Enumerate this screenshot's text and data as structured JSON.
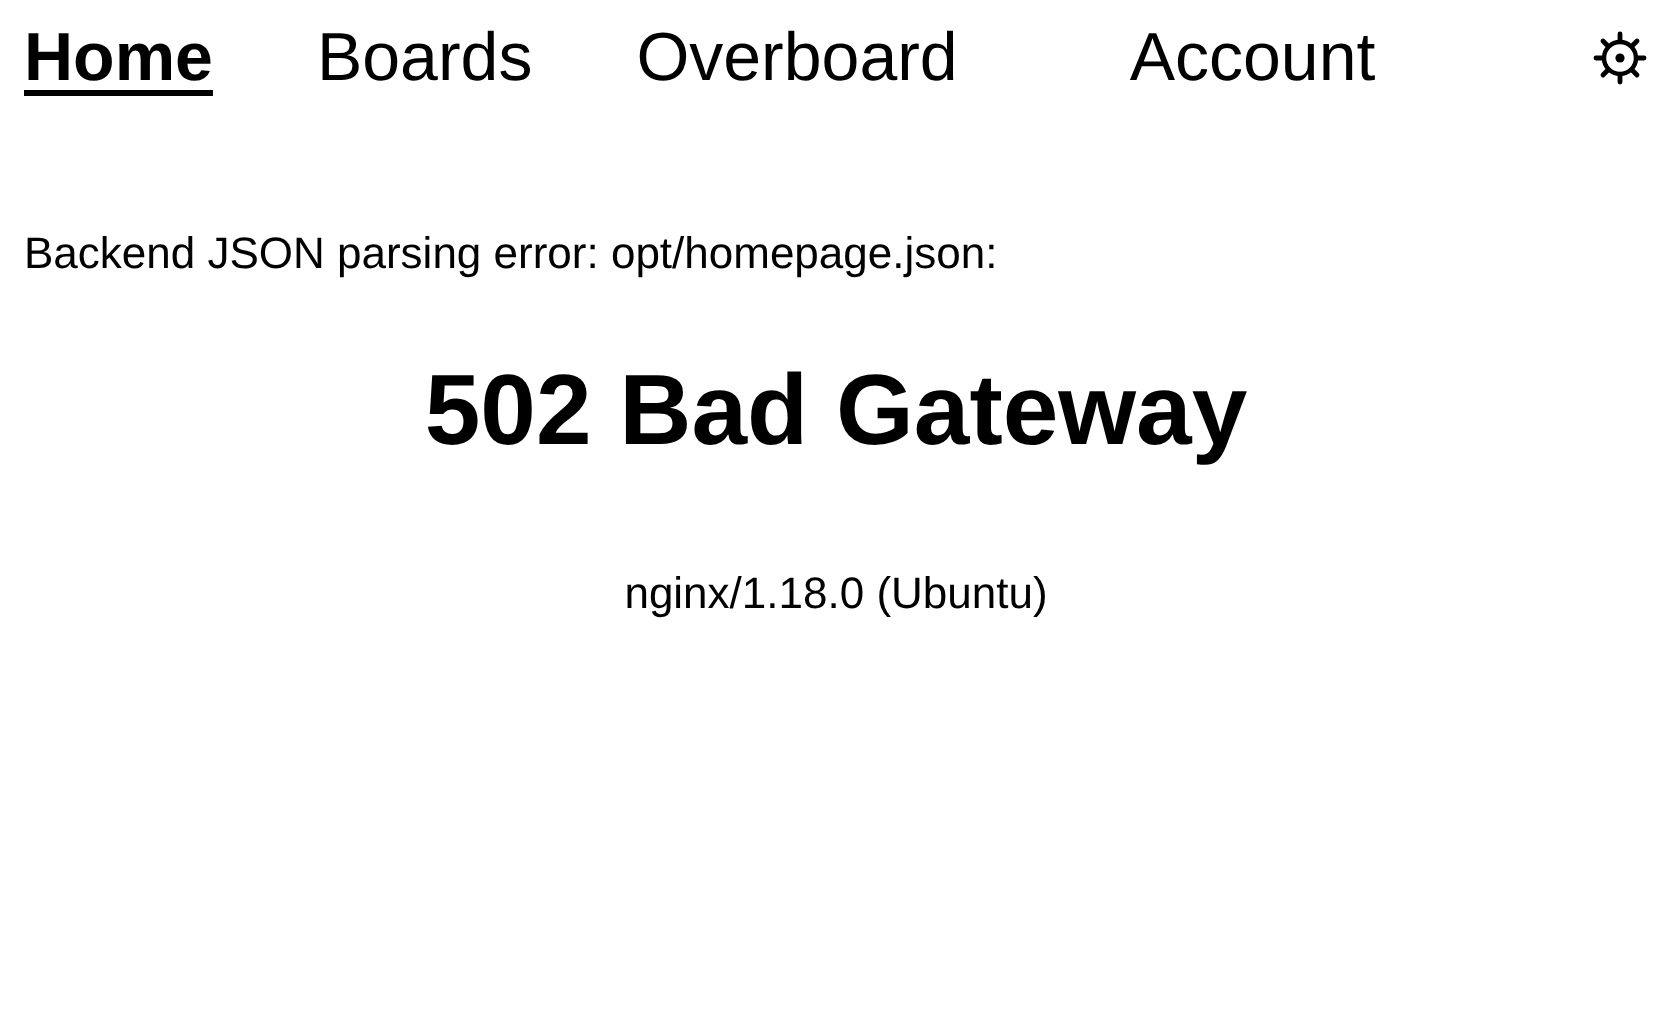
{
  "nav": [
    {
      "label": "Home",
      "selected": true
    },
    {
      "label": "Boards",
      "selected": false
    },
    {
      "label": "Overboard",
      "selected": false
    },
    {
      "label": "Account",
      "selected": false
    }
  ],
  "error": "Backend JSON parsing error: opt/homepage.json:",
  "heading": "502 Bad Gateway",
  "server": "nginx/1.18.0 (Ubuntu)"
}
